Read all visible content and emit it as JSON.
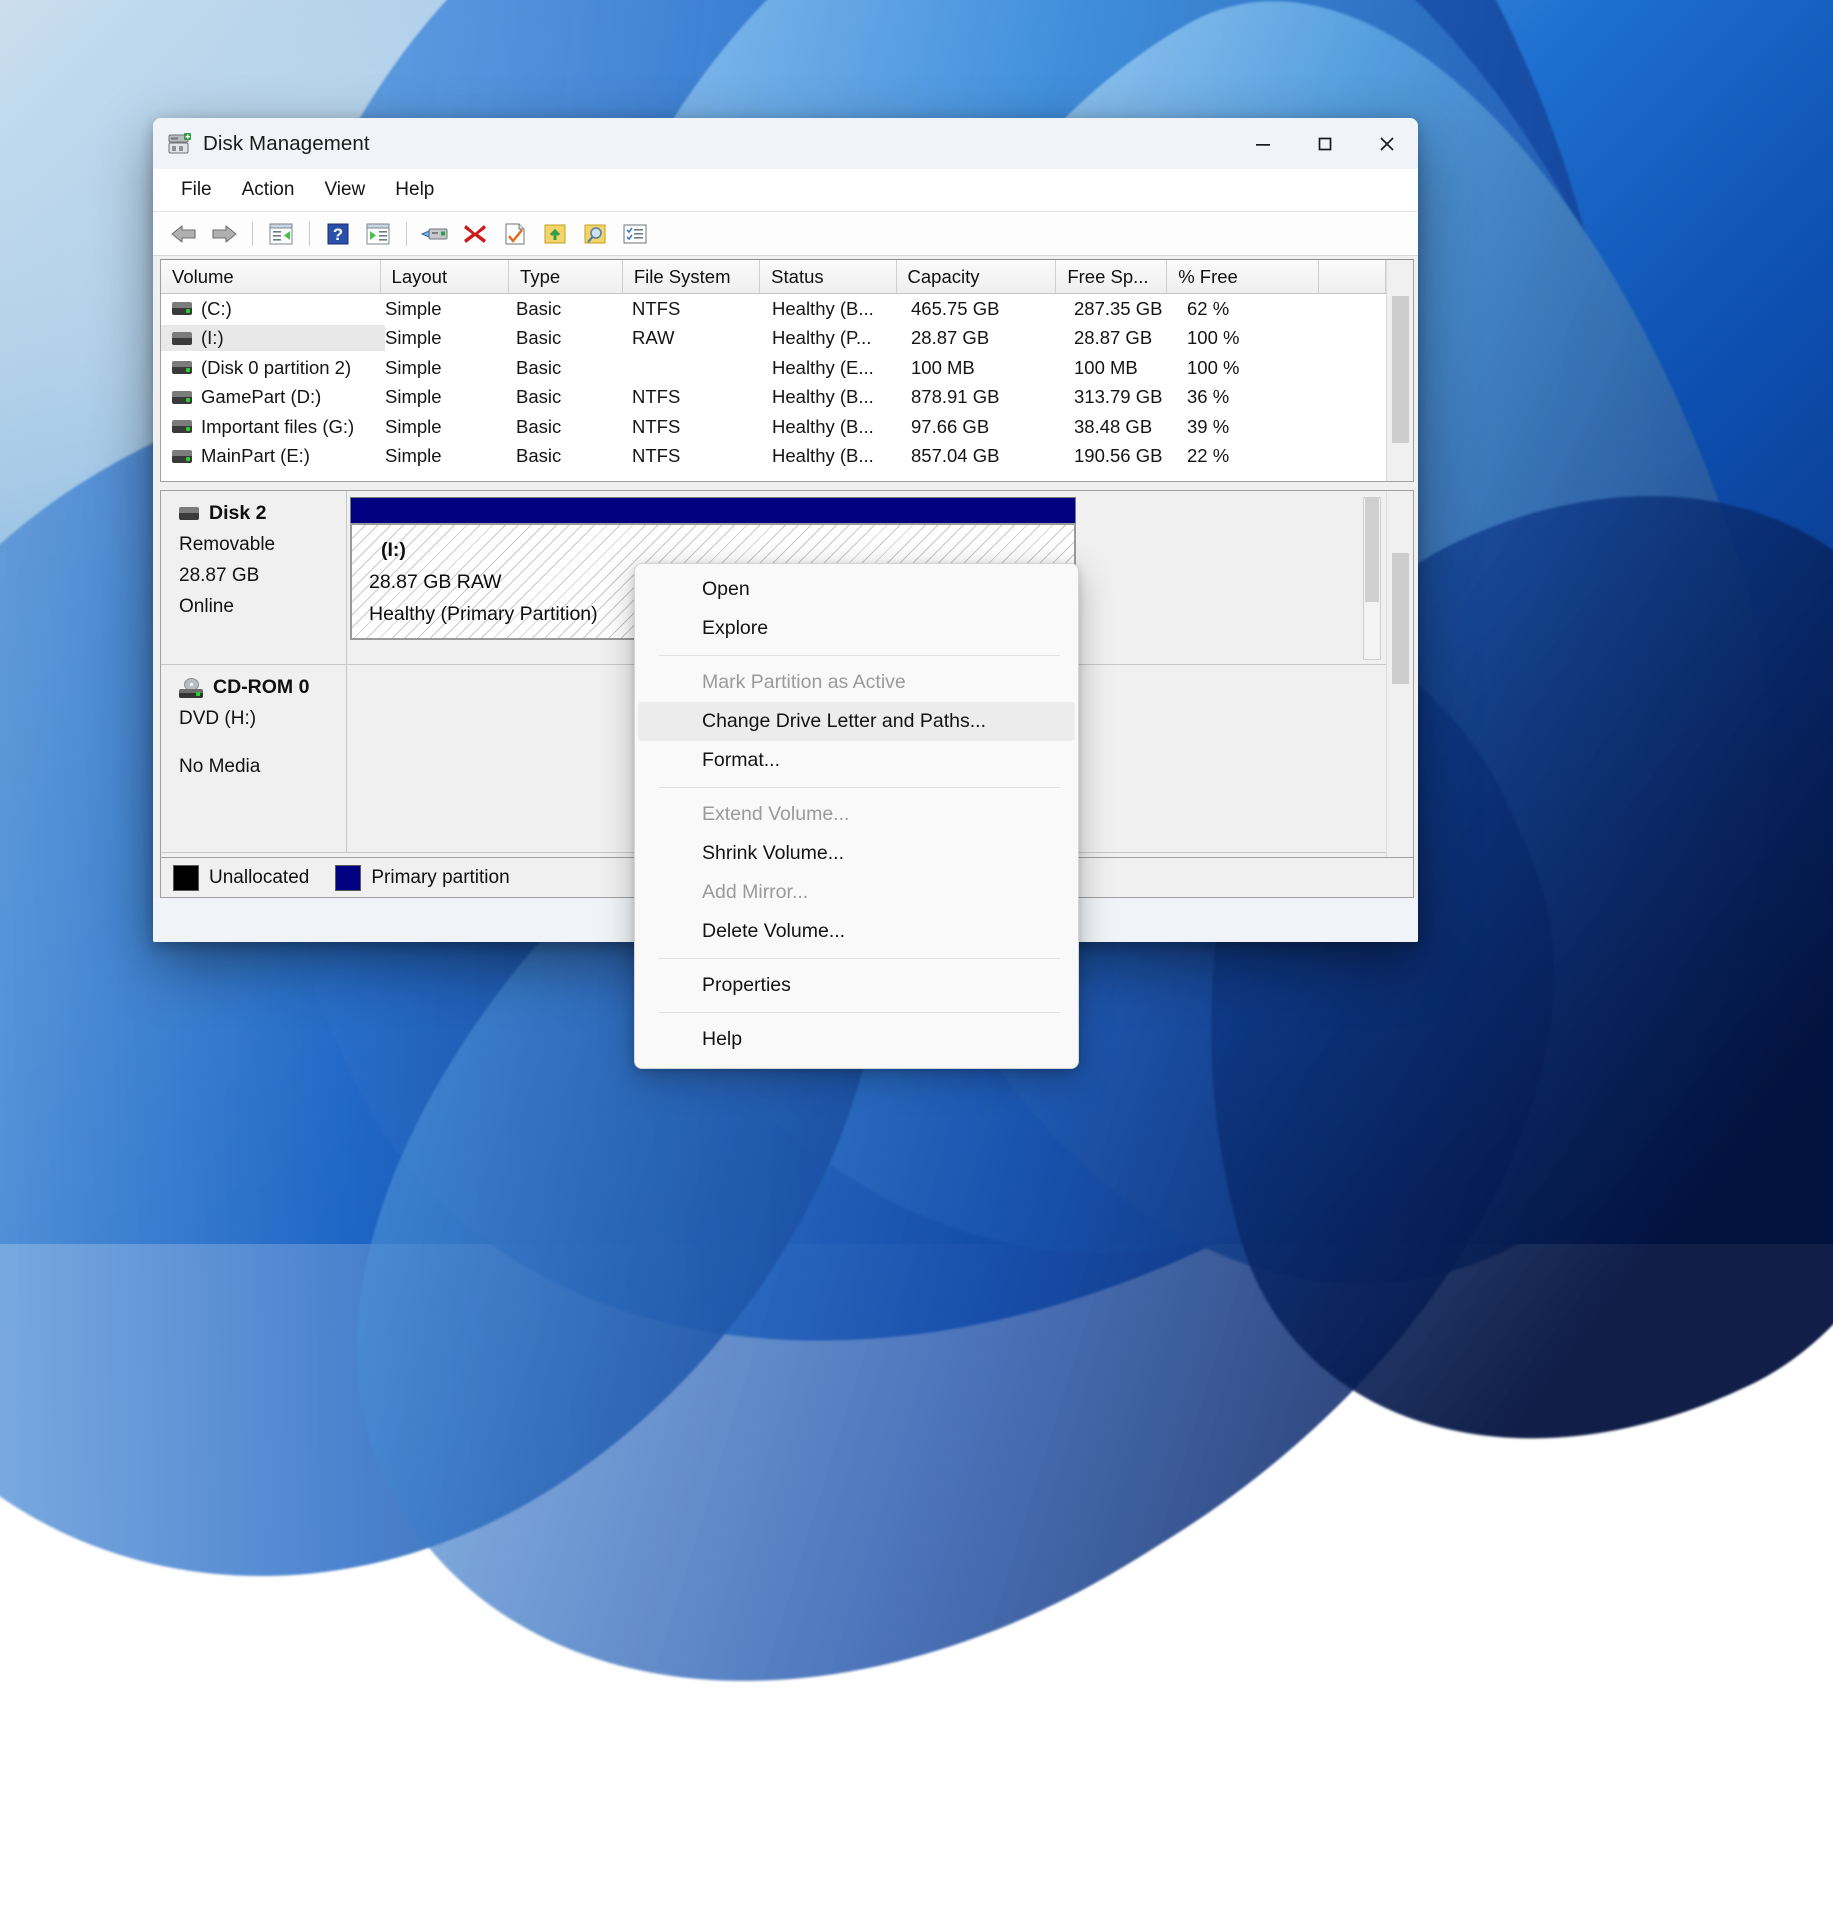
{
  "window": {
    "title": "Disk Management",
    "icon": "disk-management-icon",
    "controls": {
      "minimize": "minimize-icon",
      "maximize": "maximize-icon",
      "close": "close-icon"
    }
  },
  "menubar": {
    "items": [
      {
        "label": "File"
      },
      {
        "label": "Action"
      },
      {
        "label": "View"
      },
      {
        "label": "Help"
      }
    ]
  },
  "toolbar": {
    "buttons": [
      {
        "name": "back-icon"
      },
      {
        "name": "forward-icon"
      },
      {
        "name": "show-hide-console-tree-icon"
      },
      {
        "name": "help-icon"
      },
      {
        "name": "show-hide-action-pane-icon"
      },
      {
        "name": "rescan-disks-icon"
      },
      {
        "name": "delete-icon"
      },
      {
        "name": "properties-icon"
      },
      {
        "name": "export-list-icon"
      },
      {
        "name": "folder-search-icon"
      },
      {
        "name": "task-list-icon"
      }
    ]
  },
  "volume_list": {
    "columns": [
      {
        "label": "Volume"
      },
      {
        "label": "Layout"
      },
      {
        "label": "Type"
      },
      {
        "label": "File System"
      },
      {
        "label": "Status"
      },
      {
        "label": "Capacity"
      },
      {
        "label": "Free Sp..."
      },
      {
        "label": "% Free"
      },
      {
        "label": ""
      }
    ],
    "rows": [
      {
        "volume": "(C:)",
        "layout": "Simple",
        "type": "Basic",
        "file_system": "NTFS",
        "status": "Healthy (B...",
        "capacity": "465.75 GB",
        "free_space": "287.35 GB",
        "percent_free": "62 %",
        "selected": false,
        "icon": "drive-icon"
      },
      {
        "volume": "(I:)",
        "layout": "Simple",
        "type": "Basic",
        "file_system": "RAW",
        "status": "Healthy (P...",
        "capacity": "28.87 GB",
        "free_space": "28.87 GB",
        "percent_free": "100 %",
        "selected": true,
        "icon": "drive-icon-raw"
      },
      {
        "volume": "(Disk 0 partition 2)",
        "layout": "Simple",
        "type": "Basic",
        "file_system": "",
        "status": "Healthy (E...",
        "capacity": "100 MB",
        "free_space": "100 MB",
        "percent_free": "100 %",
        "selected": false,
        "icon": "drive-icon"
      },
      {
        "volume": "GamePart (D:)",
        "layout": "Simple",
        "type": "Basic",
        "file_system": "NTFS",
        "status": "Healthy (B...",
        "capacity": "878.91 GB",
        "free_space": "313.79 GB",
        "percent_free": "36 %",
        "selected": false,
        "icon": "drive-icon"
      },
      {
        "volume": "Important files (G:)",
        "layout": "Simple",
        "type": "Basic",
        "file_system": "NTFS",
        "status": "Healthy (B...",
        "capacity": "97.66 GB",
        "free_space": "38.48 GB",
        "percent_free": "39 %",
        "selected": false,
        "icon": "drive-icon"
      },
      {
        "volume": "MainPart (E:)",
        "layout": "Simple",
        "type": "Basic",
        "file_system": "NTFS",
        "status": "Healthy (B...",
        "capacity": "857.04 GB",
        "free_space": "190.56 GB",
        "percent_free": "22 %",
        "selected": false,
        "icon": "drive-icon"
      }
    ]
  },
  "disks": [
    {
      "name": "Disk 2",
      "icon": "disk-icon",
      "kind": "Removable",
      "size": "28.87 GB",
      "state": "Online",
      "partition": {
        "label": "(I:)",
        "size_fs": "28.87 GB RAW",
        "status": "Healthy (Primary Partition)",
        "bar_color": "#000080",
        "selected": true
      }
    },
    {
      "name": "CD-ROM 0",
      "icon": "cdrom-icon",
      "kind": "DVD (H:)",
      "size": "",
      "state": "No Media",
      "partition": null
    }
  ],
  "legend": [
    {
      "label": "Unallocated",
      "color": "#000000"
    },
    {
      "label": "Primary partition",
      "color": "#000080"
    }
  ],
  "context_menu": {
    "items": [
      {
        "label": "Open",
        "disabled": false,
        "highlight": false,
        "sep_after": false
      },
      {
        "label": "Explore",
        "disabled": false,
        "highlight": false,
        "sep_after": true
      },
      {
        "label": "Mark Partition as Active",
        "disabled": true,
        "highlight": false,
        "sep_after": false
      },
      {
        "label": "Change Drive Letter and Paths...",
        "disabled": false,
        "highlight": true,
        "sep_after": false
      },
      {
        "label": "Format...",
        "disabled": false,
        "highlight": false,
        "sep_after": true
      },
      {
        "label": "Extend Volume...",
        "disabled": true,
        "highlight": false,
        "sep_after": false
      },
      {
        "label": "Shrink Volume...",
        "disabled": false,
        "highlight": false,
        "sep_after": false
      },
      {
        "label": "Add Mirror...",
        "disabled": true,
        "highlight": false,
        "sep_after": false
      },
      {
        "label": "Delete Volume...",
        "disabled": false,
        "highlight": false,
        "sep_after": true
      },
      {
        "label": "Properties",
        "disabled": false,
        "highlight": false,
        "sep_after": true
      },
      {
        "label": "Help",
        "disabled": false,
        "highlight": false,
        "sep_after": false
      }
    ]
  }
}
